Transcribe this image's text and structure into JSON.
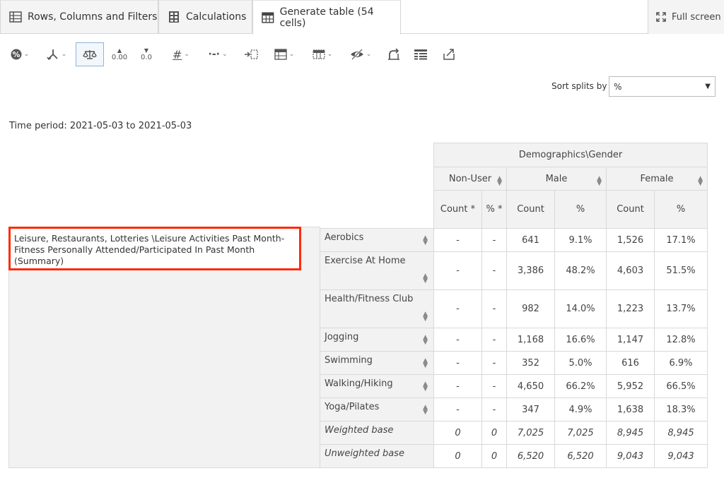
{
  "tabs": [
    {
      "label": "Rows, Columns and Filters",
      "icon": "rows-columns-icon"
    },
    {
      "label": "Calculations",
      "icon": "calculator-icon"
    },
    {
      "label": "Generate table (54 cells)",
      "icon": "table-icon",
      "active": true
    }
  ],
  "fullscreen_label": "Full screen",
  "toolbar": {
    "items": [
      "percent-icon",
      "split-icon",
      "balance-icon",
      "increase-decimals-icon",
      "decrease-decimals-icon",
      "hash-icon",
      "dash-icon",
      "collapse-icon",
      "layout-icon",
      "columns-icon",
      "hide-icon",
      "swap-icon",
      "transpose-icon",
      "export-icon"
    ],
    "increase_decimals": "0.00",
    "decrease_decimals": "0.0"
  },
  "sort": {
    "label": "Sort splits by",
    "value": "%"
  },
  "time_period": "Time period: 2021-05-03 to 2021-05-03",
  "table": {
    "group_header": "Demographics\\Gender",
    "columns": [
      {
        "name": "Non-User",
        "subs": [
          "Count *",
          "% *"
        ]
      },
      {
        "name": "Male",
        "subs": [
          "Count",
          "%"
        ]
      },
      {
        "name": "Female",
        "subs": [
          "Count",
          "%"
        ]
      }
    ],
    "row_group_label": "Leisure, Restaurants, Lotteries \\Leisure Activities Past Month-Fitness Personally Attended/Participated In Past Month (Summary)",
    "rows": [
      {
        "label": "Aerobics",
        "values": [
          "-",
          "-",
          "641",
          "9.1%",
          "1,526",
          "17.1%"
        ]
      },
      {
        "label": "Exercise At Home",
        "values": [
          "-",
          "-",
          "3,386",
          "48.2%",
          "4,603",
          "51.5%"
        ]
      },
      {
        "label": "Health/Fitness Club",
        "values": [
          "-",
          "-",
          "982",
          "14.0%",
          "1,223",
          "13.7%"
        ]
      },
      {
        "label": "Jogging",
        "values": [
          "-",
          "-",
          "1,168",
          "16.6%",
          "1,147",
          "12.8%"
        ]
      },
      {
        "label": "Swimming",
        "values": [
          "-",
          "-",
          "352",
          "5.0%",
          "616",
          "6.9%"
        ]
      },
      {
        "label": "Walking/Hiking",
        "values": [
          "-",
          "-",
          "4,650",
          "66.2%",
          "5,952",
          "66.5%"
        ]
      },
      {
        "label": "Yoga/Pilates",
        "values": [
          "-",
          "-",
          "347",
          "4.9%",
          "1,638",
          "18.3%"
        ]
      },
      {
        "label": "Weighted base",
        "values": [
          "0",
          "0",
          "7,025",
          "7,025",
          "8,945",
          "8,945"
        ],
        "italic": true
      },
      {
        "label": "Unweighted base",
        "values": [
          "0",
          "0",
          "6,520",
          "6,520",
          "9,043",
          "9,043"
        ],
        "italic": true
      }
    ]
  },
  "colors": {
    "highlight": "#ff2a0a",
    "header_bg": "#f2f2f2",
    "border": "#d9d9d9"
  }
}
